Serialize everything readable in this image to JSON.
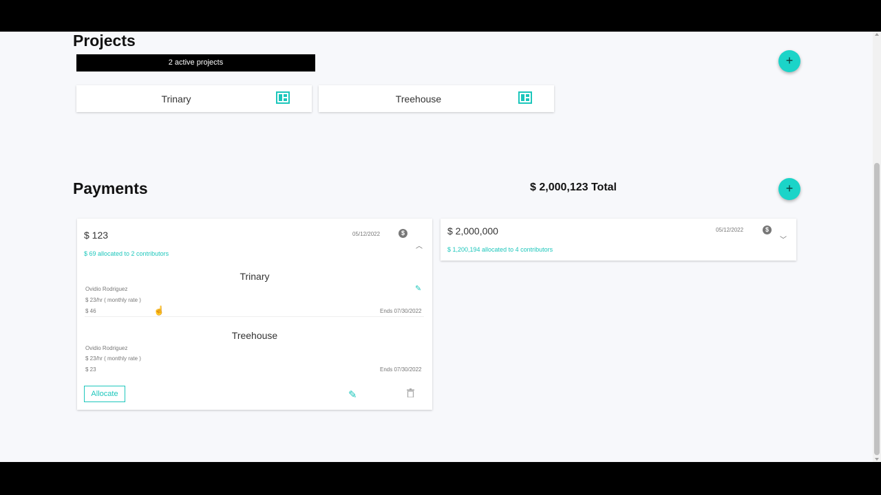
{
  "projects": {
    "title": "Projects",
    "active_summary": "2 active projects",
    "add_icon": "plus-icon",
    "items": [
      {
        "name": "Trinary",
        "icon": "ledger-icon"
      },
      {
        "name": "Treehouse",
        "icon": "ledger-icon"
      }
    ]
  },
  "payments": {
    "title": "Payments",
    "total": "$ 2,000,123 Total",
    "add_icon": "plus-icon",
    "cards": [
      {
        "amount": "$ 123",
        "date": "05/12/2022",
        "allocation_summary": "$ 69 allocated to 2 contributors",
        "expanded": true,
        "allocations": [
          {
            "project": "Trinary",
            "contributor": "Ovidio Rodriguez",
            "rate": "$ 23/hr ( monthly rate )",
            "amount": "$ 46",
            "ends": "Ends 07/30/2022"
          },
          {
            "project": "Treehouse",
            "contributor": "Ovidio Rodriguez",
            "rate": "$ 23/hr ( monthly rate )",
            "amount": "$ 23",
            "ends": "Ends 07/30/2022"
          }
        ],
        "allocate_label": "Allocate"
      },
      {
        "amount": "$ 2,000,000",
        "date": "05/12/2022",
        "allocation_summary": "$ 1,200,194 allocated to 4 contributors",
        "expanded": false
      }
    ]
  },
  "colors": {
    "accent": "#1bd4c8",
    "page_bg": "#f7f8fb",
    "active_bar": "#000000"
  }
}
